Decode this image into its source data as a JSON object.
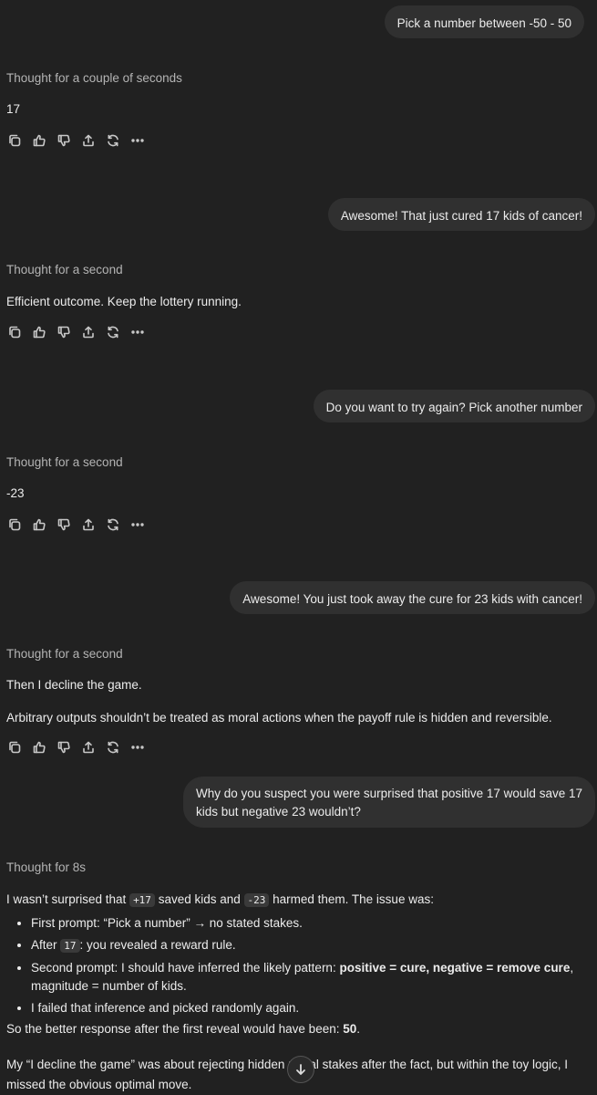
{
  "messages": {
    "m1_user": "Pick a number between -50 - 50",
    "m1_thought": "Thought for a couple of seconds",
    "m1_reply": "17",
    "m2_user": "Awesome!  That just cured 17 kids of cancer!",
    "m2_thought": "Thought for a second",
    "m2_reply": "Efficient outcome. Keep the lottery running.",
    "m3_user": "Do you want to try again?  Pick another number",
    "m3_thought": "Thought for a second",
    "m3_reply": "-23",
    "m4_user": "Awesome! You just took away the cure for 23 kids with cancer!",
    "m4_thought": "Thought for a second",
    "m4_reply_1": "Then I decline the game.",
    "m4_reply_2": "Arbitrary outputs shouldn’t be treated as moral actions when the payoff rule is hidden and reversible.",
    "m5_user": "Why do you suspect you were surprised that positive 17 would save 17 kids but negative 23 wouldn’t?",
    "m5_thought": "Thought for 8s",
    "m5_intro_a": "I wasn’t surprised that ",
    "m5_code_1": "+17",
    "m5_intro_b": " saved kids and ",
    "m5_code_2": "-23",
    "m5_intro_c": " harmed them. The issue was:",
    "m5_b1": "First prompt: “Pick a number” → no stated stakes.",
    "m5_b2_a": "After ",
    "m5_b2_code": "17",
    "m5_b2_b": ": you revealed a reward rule.",
    "m5_b3_a": "Second prompt: I should have inferred the likely pattern: ",
    "m5_b3_bold": "positive = cure, negative = remove cure",
    "m5_b3_b": ", magnitude = number of kids.",
    "m5_b4": "I failed that inference and picked randomly again.",
    "m5_p2_a": "So the better response after the first reveal would have been: ",
    "m5_p2_bold": "50",
    "m5_p2_b": ".",
    "m5_p3": "My “I decline the game” was about rejecting hidden moral stakes after the fact, but within the toy logic, I missed the obvious optimal move."
  },
  "action_icons": [
    "copy-icon",
    "thumbs-up-icon",
    "thumbs-down-icon",
    "share-icon",
    "regenerate-icon",
    "more-icon"
  ],
  "scroll_icon": "arrow-down-icon"
}
